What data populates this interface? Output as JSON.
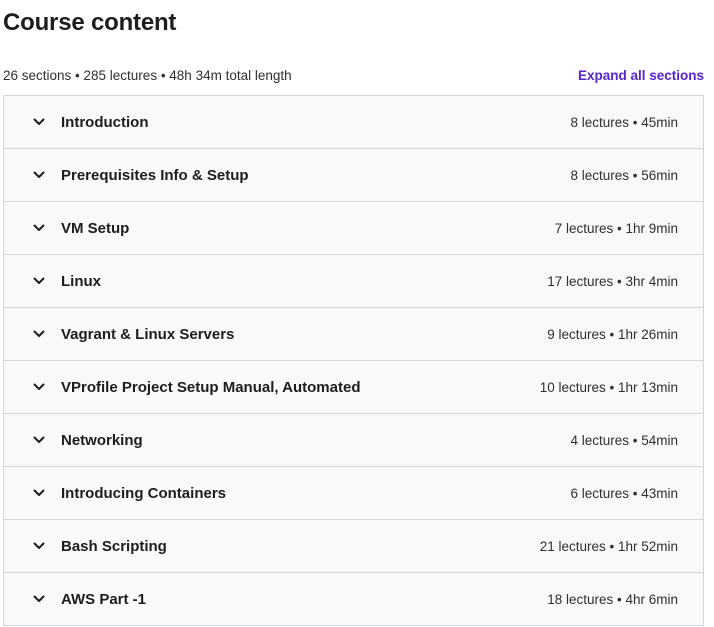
{
  "header": {
    "title": "Course content",
    "summary": "26 sections • 285 lectures • 48h 34m total length",
    "expand_label": "Expand all sections"
  },
  "sections": [
    {
      "title": "Introduction",
      "meta": "8 lectures • 45min"
    },
    {
      "title": "Prerequisites Info & Setup",
      "meta": "8 lectures • 56min"
    },
    {
      "title": "VM Setup",
      "meta": "7 lectures • 1hr 9min"
    },
    {
      "title": "Linux",
      "meta": "17 lectures • 3hr 4min"
    },
    {
      "title": "Vagrant & Linux Servers",
      "meta": "9 lectures • 1hr 26min"
    },
    {
      "title": "VProfile Project Setup Manual, Automated",
      "meta": "10 lectures • 1hr 13min"
    },
    {
      "title": "Networking",
      "meta": "4 lectures • 54min"
    },
    {
      "title": "Introducing Containers",
      "meta": "6 lectures • 43min"
    },
    {
      "title": "Bash Scripting",
      "meta": "21 lectures • 1hr 52min"
    },
    {
      "title": "AWS Part -1",
      "meta": "18 lectures • 4hr 6min"
    }
  ],
  "icons": {
    "section_toggle": "chevron-down-icon"
  },
  "colors": {
    "link": "#5624d0",
    "section_bg": "#f7f9fa",
    "border": "#d1d7dc",
    "text": "#1c1d1f"
  }
}
